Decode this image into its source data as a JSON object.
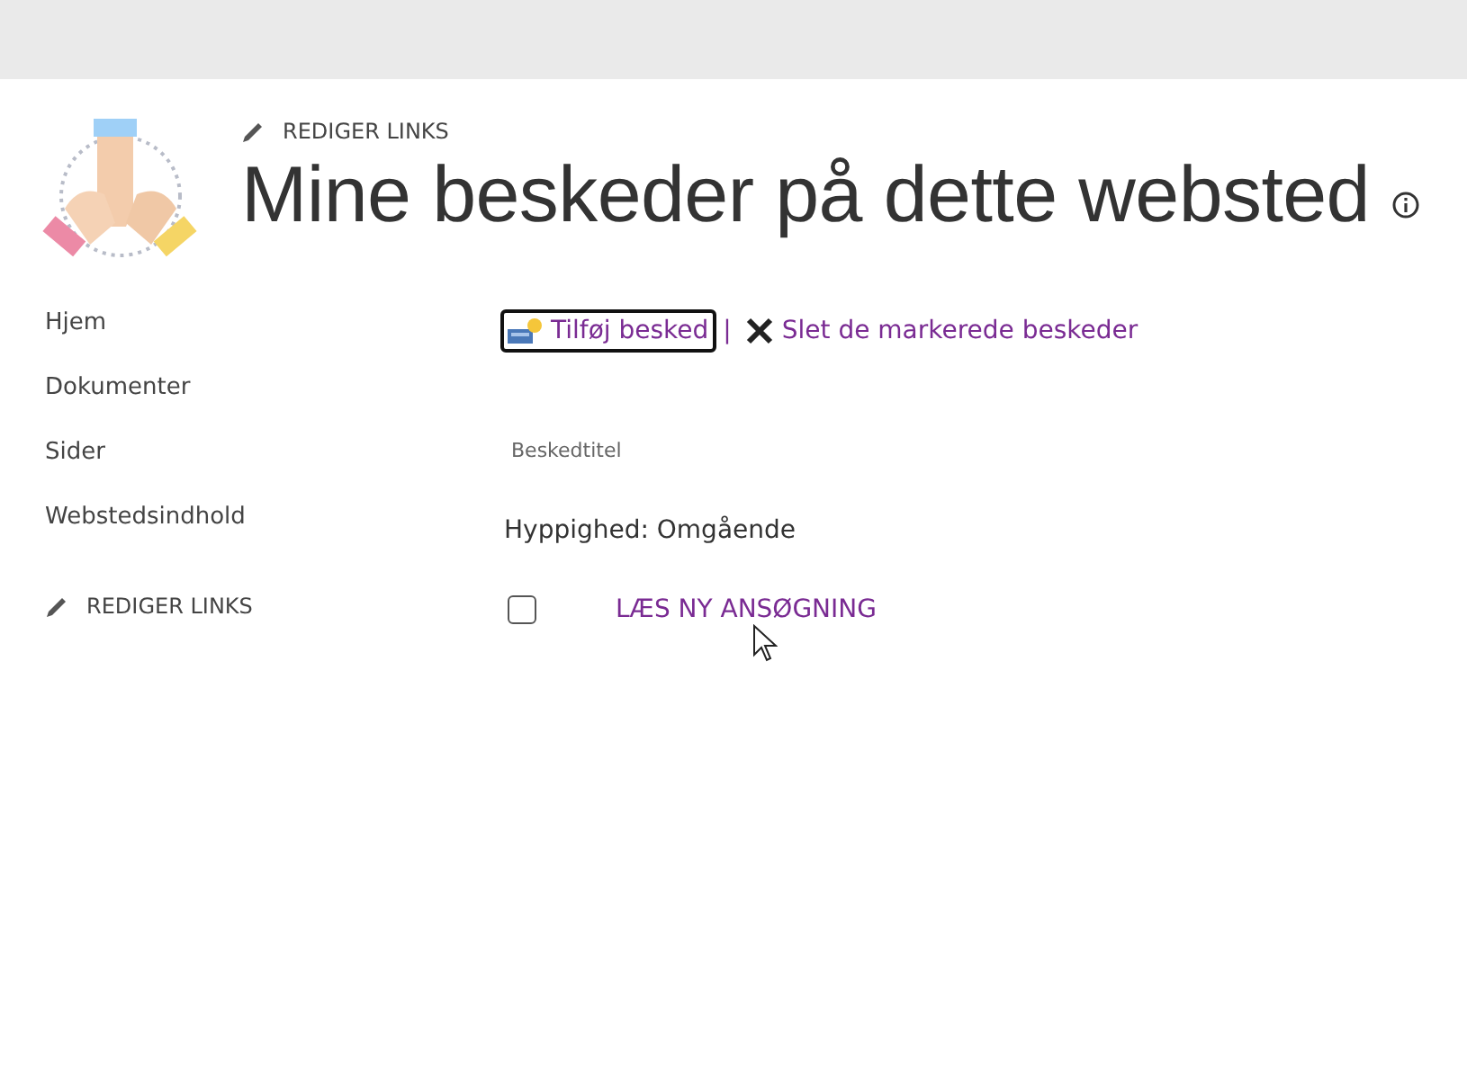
{
  "header": {
    "edit_links": "REDIGER LINKS",
    "title": "Mine beskeder på dette websted"
  },
  "sidebar": {
    "items": [
      {
        "label": "Hjem"
      },
      {
        "label": "Dokumenter"
      },
      {
        "label": "Sider"
      },
      {
        "label": "Webstedsindhold"
      }
    ],
    "edit_links": "REDIGER LINKS"
  },
  "toolbar_separator": "|",
  "toolbar": [
    {
      "kind": "add",
      "label": "Tilføj besked",
      "focused": true
    },
    {
      "kind": "delete",
      "label": "Slet de markerede beskeder",
      "focused": false
    }
  ],
  "column_header": "Beskedtitel",
  "group": "Hyppighed: Omgående",
  "alerts": [
    {
      "title": "LÆS NY ANSØGNING",
      "checked": false
    }
  ]
}
